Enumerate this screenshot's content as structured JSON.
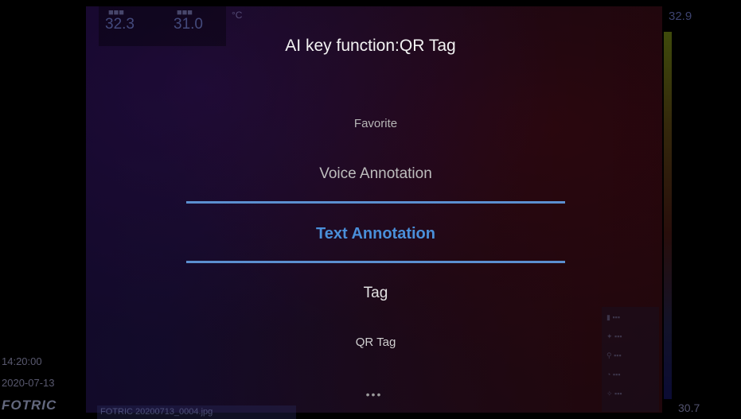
{
  "dialog": {
    "title": "AI key function:QR Tag",
    "options": [
      "Favorite",
      "Voice Annotation",
      "Text Annotation",
      "Tag",
      "QR Tag"
    ],
    "selected": "Text Annotation",
    "more": "•••"
  },
  "thermal": {
    "temp_values": [
      "32.3",
      "31.0"
    ],
    "unit": "°C",
    "scale_max": "32.9",
    "scale_min": "30.7"
  },
  "footer": {
    "time": "14:20:00",
    "date": "2020-07-13",
    "brand": "FOTRIC",
    "filename": "FOTRIC 20200713_0004.jpg"
  },
  "colors": {
    "accent": "#4a8fd9",
    "divider": "#5b8fd0"
  }
}
